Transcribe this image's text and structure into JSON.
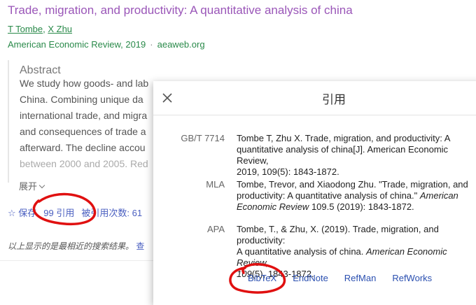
{
  "result": {
    "title": "Trade, migration, and productivity: A quantitative analysis of china",
    "authors": [
      "T Tombe",
      "X Zhu"
    ],
    "author_sep": ", ",
    "venue": "American Economic Review, 2019",
    "source": "aeaweb.org"
  },
  "abstract": {
    "heading": "Abstract",
    "lines": [
      "We study how goods- and lab",
      "China. Combining unique da",
      "international trade, and migra",
      "and consequences of trade a",
      "afterward. The decline accou",
      "between 2000 and 2005. Red"
    ],
    "expand_label": "展开"
  },
  "actions": {
    "save": "☆ 保存",
    "cite": "99 引用",
    "cited_by": "被引用次数: 61"
  },
  "footer_note": "以上显示的是最相近的搜索结果。",
  "footer_link": "查",
  "cite_dialog": {
    "title": "引用",
    "styles": [
      {
        "label": "GB/T 7714",
        "lines": [
          "Tombe T, Zhu X. Trade, migration, and productivity: A",
          "quantitative analysis of china[J]. American Economic Review,",
          "2019, 109(5): 1843-1872."
        ]
      },
      {
        "label": "MLA",
        "lines": [
          "Tombe, Trevor, and Xiaodong Zhu. \"Trade, migration, and",
          "productivity: A quantitative analysis of china.\" <i>American</i>",
          "<i>Economic Review</i> 109.5 (2019): 1843-1872."
        ]
      },
      {
        "label": "APA",
        "lines": [
          "Tombe, T., & Zhu, X. (2019). Trade, migration, and productivity:",
          "A quantitative analysis of china. <i>American Economic Review,</i>",
          "<i>109</i>(5), 1843-1872."
        ]
      }
    ],
    "exports": [
      "BibTeX",
      "EndNote",
      "RefMan",
      "RefWorks"
    ]
  },
  "colors": {
    "title": "#9a56b8",
    "green": "#2a8a4a",
    "link": "#2a4fb0",
    "annotation": "#e01010"
  },
  "icons": {
    "close": "close-icon",
    "save": "star-icon",
    "cite": "quote-icon",
    "expand": "chevron-down-icon"
  }
}
